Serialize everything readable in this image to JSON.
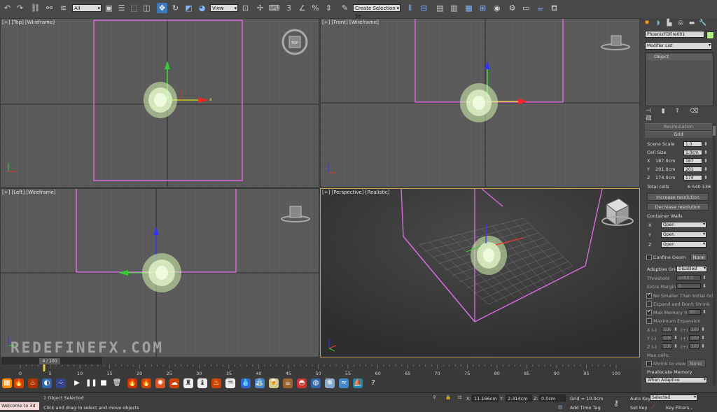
{
  "toolbar": {
    "selection_filter": "All",
    "view_dropdown": "View",
    "named_selection": "Create Selection Se"
  },
  "viewports": {
    "top": {
      "label": "[+] [Top] [Wireframe]"
    },
    "front": {
      "label": "[+] [Front] [Wireframe]"
    },
    "left": {
      "label": "[+] [Left] [Wireframe]"
    },
    "perspective": {
      "label": "[+] [Perspective] [Realistic]"
    },
    "axis_x": "x",
    "nav_cube_top": "TOP"
  },
  "watermark": "REDEFINEFX.COM",
  "command_panel": {
    "object_name": "PhoenixFDFire001",
    "modifier_list": "Modifier List",
    "stack_item": "Object",
    "rollout_title": "Grid",
    "rollout_prev": "Resimulation",
    "scene_scale_label": "Scene Scale",
    "scene_scale": "1.0",
    "cell_size_label": "Cell Size",
    "cell_size": "1.0cm",
    "x_label": "X",
    "x_size": "187.0cm",
    "x_cells": "187",
    "y_label": "Y",
    "y_size": "201.0cm",
    "y_cells": "201",
    "z_label": "Z",
    "z_size": "174.0cm",
    "z_cells": "174",
    "total_cells_label": "Total cells",
    "total_cells": "6 540 138",
    "increase_btn": "Increase resolution",
    "decrease_btn": "Decrease resolution",
    "container_walls_label": "Container Walls",
    "wall_x_label": "X",
    "wall_x": "Open",
    "wall_y_label": "Y",
    "wall_y": "Open",
    "wall_z_label": "Z",
    "wall_z": "Open",
    "confine_geom_label": "Confine Geom",
    "confine_geom_btn": "None",
    "adaptive_grid_label": "Adaptive Grid",
    "adaptive_grid": "Disabled",
    "threshold_label": "Threshold",
    "threshold": "1000.0",
    "extra_margin_label": "Extra Margin",
    "extra_margin": "0",
    "no_smaller_label": "No Smaller Than Initial Grid",
    "expand_label": "Expand and Don't Shrink",
    "max_memory_label": "Max Memory %",
    "max_memory": "90",
    "max_expansion_label": "Maximum Expansion",
    "xneg_label": "X (-)",
    "xneg": "100",
    "xpos_label": "(+)",
    "xpos": "100",
    "yneg_label": "Y (-)",
    "yneg": "100",
    "ypos_label": "(+)",
    "ypos": "100",
    "zneg_label": "Z (-)",
    "zneg": "100",
    "zpos_label": "(+)",
    "zpos": "100",
    "max_cells_label": "Max cells:",
    "shrink_label": "Shrink to view",
    "shrink_btn": "None",
    "preallocate_label": "Preallocate Memory",
    "preallocate": "When Adaptive"
  },
  "timeline": {
    "frame_counter": "4 / 100",
    "ticks": [
      "0",
      "5",
      "10",
      "15",
      "20",
      "25",
      "30",
      "35",
      "40",
      "45",
      "50",
      "55",
      "60",
      "65",
      "70",
      "75",
      "80",
      "85",
      "90",
      "95",
      "100"
    ],
    "current_frame": 4
  },
  "status": {
    "listener": "Welcome to 3d",
    "selected": "1 Object Selected",
    "prompt": "Click and drag to select and move objects",
    "x_label": "X:",
    "x_value": "11.166cm",
    "y_label": "Y:",
    "y_value": "2.314cm",
    "z_label": "Z:",
    "z_value": "0.0cm",
    "grid": "Grid = 10.0cm",
    "add_time_tag": "Add Time Tag",
    "auto_key": "Auto Key",
    "auto_key_value": "Selected",
    "set_key": "Set Key",
    "key_filters": "Key Filters..."
  }
}
